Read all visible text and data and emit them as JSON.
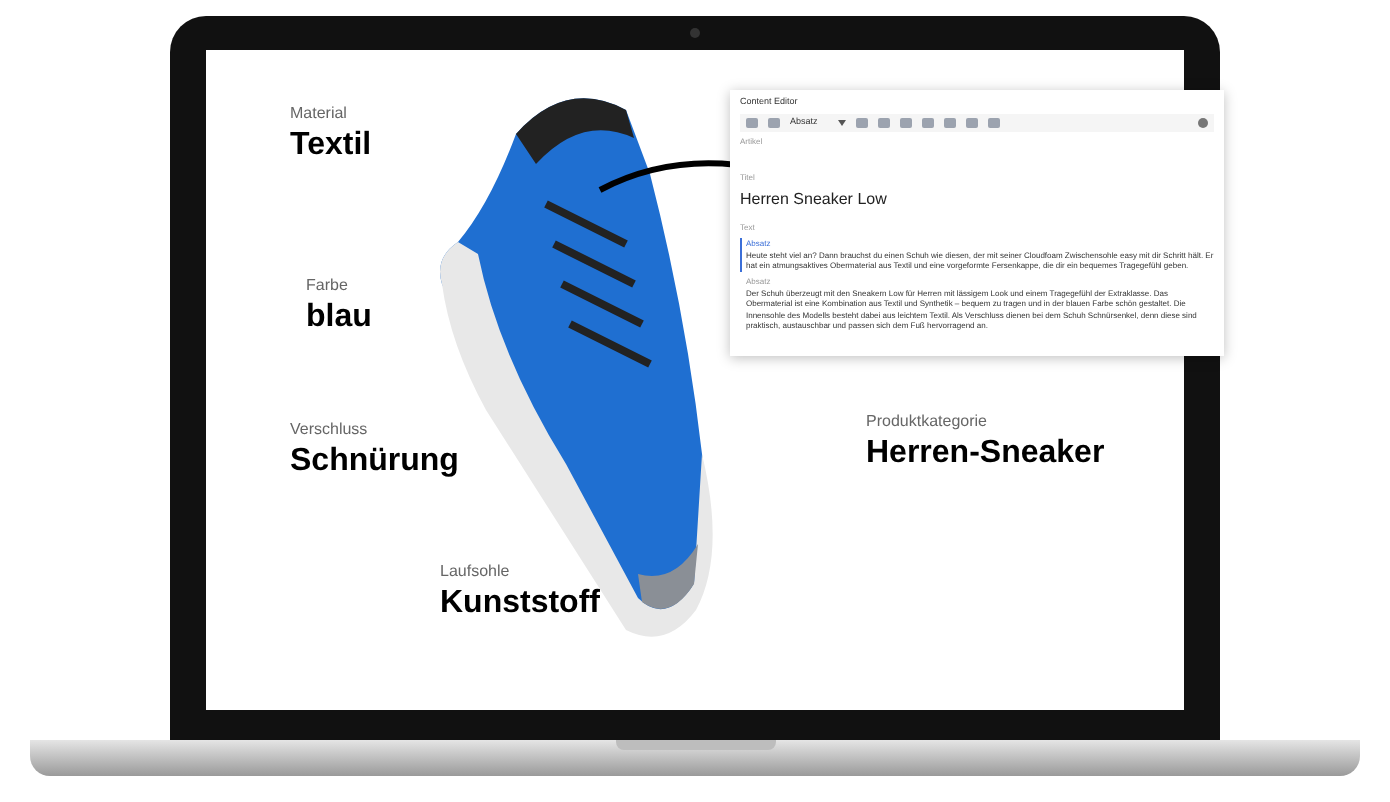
{
  "features": [
    {
      "label": "Material",
      "value": "Textil"
    },
    {
      "label": "Farbe",
      "value": "blau"
    },
    {
      "label": "Verschluss",
      "value": "Schnürung"
    },
    {
      "label": "Laufsohle",
      "value": "Kunststoff"
    },
    {
      "label": "Produktkategorie",
      "value": "Herren-Sneaker"
    }
  ],
  "editor": {
    "title": "Content Editor",
    "format": "Absatz",
    "section_label": "Artikel",
    "title_label": "Titel",
    "title_value": "Herren Sneaker Low",
    "text_label": "Text",
    "blocks": [
      {
        "label": "Absatz",
        "selected": true,
        "text": "Heute steht viel an? Dann brauchst du einen Schuh wie diesen, der mit seiner Cloudfoam Zwischensohle easy mit dir Schritt hält. Er hat ein atmungsaktives Obermaterial aus Textil und eine vorgeformte Fersenkappe, die dir ein bequemes Tragegefühl geben."
      },
      {
        "label": "Absatz",
        "selected": false,
        "text": "Der Schuh überzeugt mit den Sneakern Low für Herren mit lässigem Look und einem Tragegefühl der Extraklasse. Das Obermaterial ist eine Kombination aus Textil und Synthetik – bequem zu tragen und in der blauen Farbe schön gestaltet. Die Innensohle des Modells besteht dabei aus leichtem Textil. Als Verschluss dienen bei dem Schuh Schnürsenkel, denn diese sind praktisch, austauschbar und passen sich dem Fuß hervorragend an."
      }
    ]
  }
}
